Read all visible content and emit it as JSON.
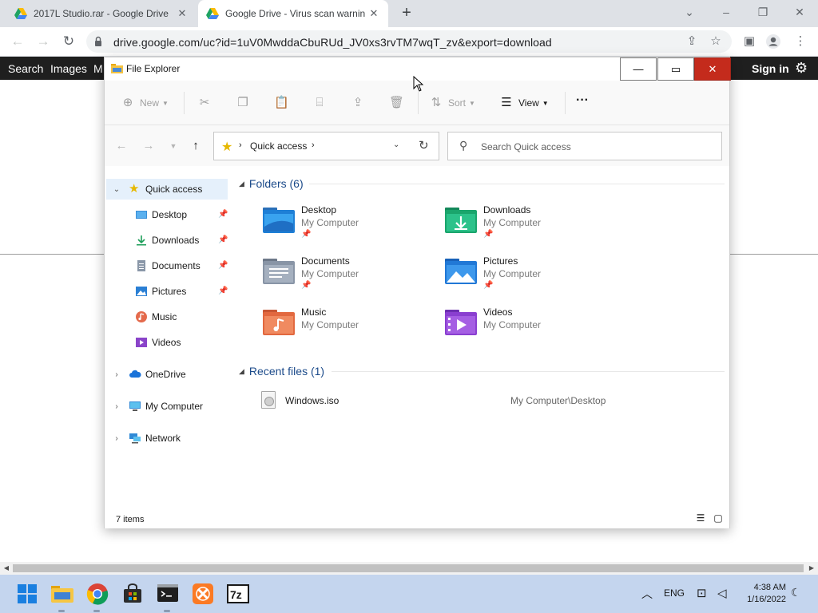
{
  "browser": {
    "tabs": [
      {
        "title": "2017L Studio.rar - Google Drive",
        "active": false
      },
      {
        "title": "Google Drive - Virus scan warnin",
        "active": true
      }
    ],
    "url": "drive.google.com/uc?id=1uV0MwddaCbuRUd_JV0xs3rvTM7wqT_zv&export=download"
  },
  "page": {
    "bar_links": [
      "Search",
      "Images",
      "M"
    ],
    "signin": "Sign in"
  },
  "explorer": {
    "title": "File Explorer",
    "commands": {
      "new": "New",
      "sort": "Sort",
      "view": "View",
      "more": "···"
    },
    "address": "Quick access",
    "search_placeholder": "Search Quick access",
    "nav": {
      "quick_access": "Quick access",
      "pinned": [
        "Desktop",
        "Downloads",
        "Documents",
        "Pictures",
        "Music",
        "Videos"
      ],
      "onedrive": "OneDrive",
      "my_computer": "My Computer",
      "network": "Network"
    },
    "folders_header": "Folders (6)",
    "folders": [
      {
        "name": "Desktop",
        "location": "My Computer",
        "pinned": true
      },
      {
        "name": "Downloads",
        "location": "My Computer",
        "pinned": true
      },
      {
        "name": "Documents",
        "location": "My Computer",
        "pinned": true
      },
      {
        "name": "Pictures",
        "location": "My Computer",
        "pinned": true
      },
      {
        "name": "Music",
        "location": "My Computer",
        "pinned": false
      },
      {
        "name": "Videos",
        "location": "My Computer",
        "pinned": false
      }
    ],
    "recent_header": "Recent files (1)",
    "recent": [
      {
        "name": "Windows.iso",
        "path": "My Computer\\Desktop"
      }
    ],
    "status": "7 items"
  },
  "taskbar": {
    "lang": "ENG",
    "time": "4:38 AM",
    "date": "1/16/2022"
  },
  "colors": {
    "close_red": "#c42b1c",
    "taskbar": "#c4d5ee",
    "accent": "#1b4a8a"
  }
}
